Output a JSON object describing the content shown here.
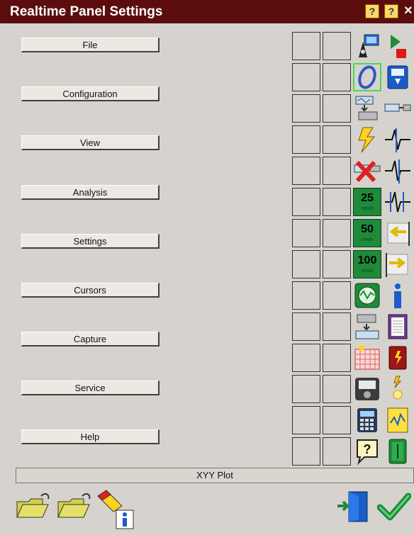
{
  "window": {
    "title": "Realtime Panel Settings"
  },
  "title_buttons": [
    {
      "name": "tip-icon",
      "glyph": "?"
    },
    {
      "name": "help-icon",
      "glyph": "?"
    },
    {
      "name": "close-icon",
      "glyph": "×"
    }
  ],
  "menu": [
    {
      "label": "File"
    },
    {
      "label": "Configuration"
    },
    {
      "label": "View"
    },
    {
      "label": "Analysis"
    },
    {
      "label": "Settings"
    },
    {
      "label": "Cursors"
    },
    {
      "label": "Capture"
    },
    {
      "label": "Service"
    },
    {
      "label": "Help"
    }
  ],
  "speeds": [
    {
      "value": "25",
      "unit": "mm/s"
    },
    {
      "value": "50",
      "unit": "mm/s"
    },
    {
      "value": "100",
      "unit": "mm/s"
    }
  ],
  "status": {
    "text": "XYY Plot"
  },
  "colors": {
    "titlebar": "#5b0d0d",
    "accent_green": "#1e8b3a",
    "selected_border": "#44dd44"
  }
}
